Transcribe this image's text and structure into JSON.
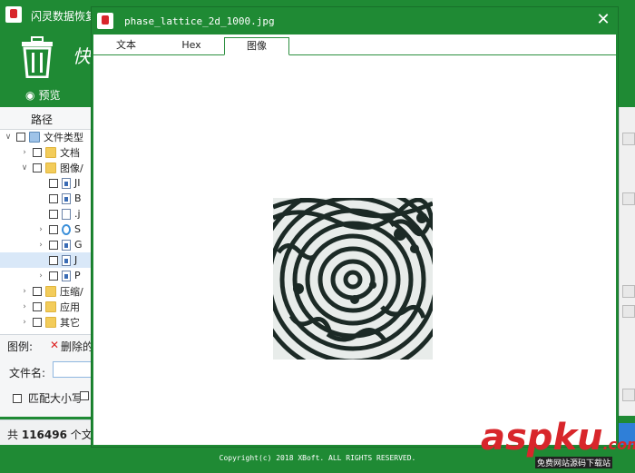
{
  "app": {
    "title": "闪灵数据恢复",
    "heading": "快",
    "preview_label": "预览",
    "tree_header": "路径",
    "tree_items": [
      {
        "label": "文件类型",
        "expanded": true,
        "kind": "drive"
      },
      {
        "label": "文档",
        "expanded": false,
        "kind": "folder"
      },
      {
        "label": "图像/",
        "expanded": true,
        "kind": "folder"
      },
      {
        "label": "JI",
        "kind": "image"
      },
      {
        "label": "B",
        "kind": "image"
      },
      {
        "label": ".j",
        "kind": "file"
      },
      {
        "label": "S",
        "kind": "ie"
      },
      {
        "label": "G",
        "kind": "image"
      },
      {
        "label": "J",
        "kind": "image",
        "selected": true
      },
      {
        "label": "P",
        "kind": "image"
      },
      {
        "label": "压缩/",
        "kind": "folder"
      },
      {
        "label": "应用",
        "kind": "folder"
      },
      {
        "label": "其它",
        "kind": "folder"
      }
    ],
    "legend_label": "图例:",
    "legend_deleted": "删除的",
    "filename_label": "文件名:",
    "filename_value": "",
    "match_case_label": "匹配大小写",
    "status_prefix": "共",
    "status_count": "116496",
    "status_suffix": "个文件",
    "copyright": "Copyright(c) 2018 XBoft. ALL RIGHTS RESERVED."
  },
  "dialog": {
    "title": "phase_lattice_2d_1000.jpg",
    "close_icon": "close-icon",
    "tabs": [
      {
        "label": "文本",
        "active": false
      },
      {
        "label": "Hex",
        "active": false
      },
      {
        "label": "图像",
        "active": true
      }
    ]
  },
  "watermark": {
    "text_a": "asp",
    "text_b": "ku",
    "text_c": ".com",
    "sub": "免费网站源码下载站"
  },
  "colors": {
    "brand_green": "#1f8a34",
    "accent_red": "#d8262b",
    "selection_blue": "#d9e8f8"
  }
}
